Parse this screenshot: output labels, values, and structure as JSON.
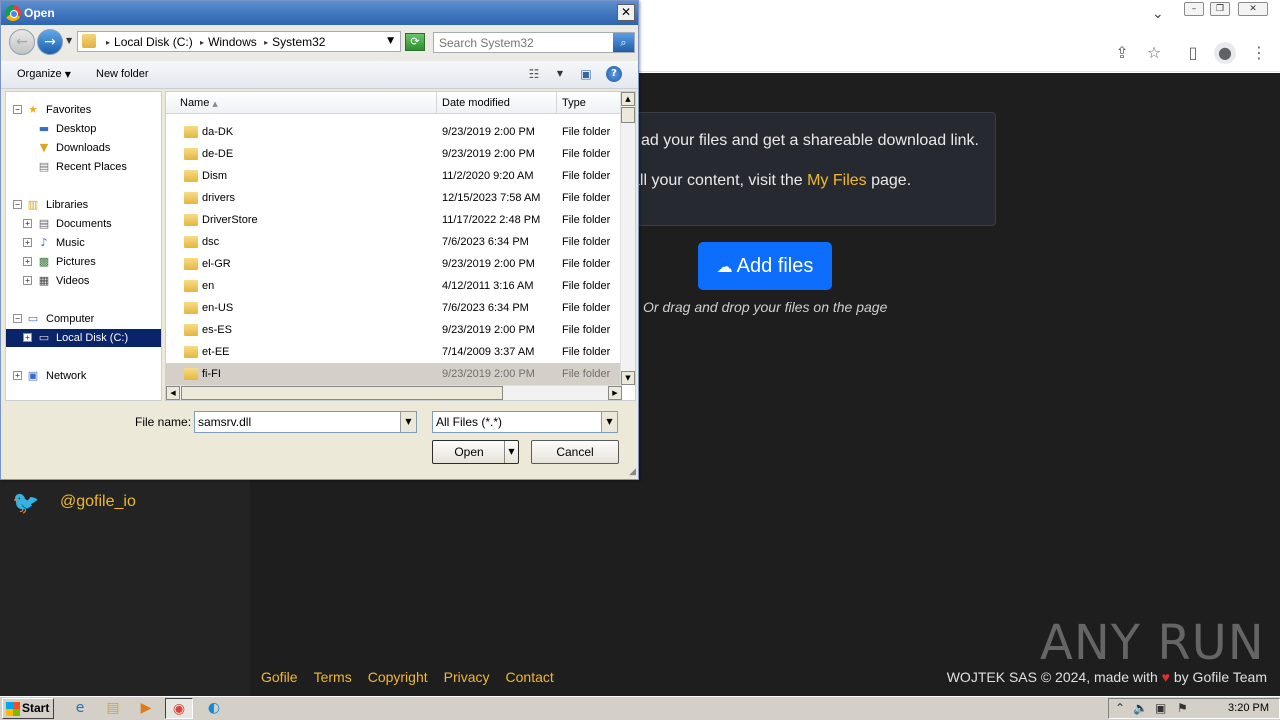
{
  "browser": {
    "toolbar_icons": [
      "share-icon",
      "star-icon",
      "sidepanel-icon",
      "profile-icon",
      "menu-icon"
    ]
  },
  "page": {
    "info_line1": "ad your files and get a shareable download link.",
    "info_line2_prefix": "all your content, visit the ",
    "info_line2_link": "My Files",
    "info_line2_suffix": " page.",
    "add_files_label": "Add files",
    "drag_hint": "Or drag and drop your files on the page",
    "twitter_handle": "@gofile_io",
    "footer_links": [
      "Gofile",
      "Terms",
      "Copyright",
      "Privacy",
      "Contact"
    ],
    "footer_right_prefix": "WOJTEK SAS © 2024, made with ",
    "footer_right_suffix": " by Gofile Team",
    "watermark": "ANY RUN",
    "colors": {
      "background": "#1e1e1e",
      "accent_link": "#f1b82d",
      "button_blue": "#0d6efd",
      "heart": "#e03131"
    }
  },
  "dialog": {
    "title": "Open",
    "address": [
      "Local Disk (C:)",
      "Windows",
      "System32"
    ],
    "search_placeholder": "Search System32",
    "organize_label": "Organize",
    "new_folder_label": "New folder",
    "nav": {
      "favorites": "Favorites",
      "desktop": "Desktop",
      "downloads": "Downloads",
      "recent": "Recent Places",
      "libraries": "Libraries",
      "documents": "Documents",
      "music": "Music",
      "pictures": "Pictures",
      "videos": "Videos",
      "computer": "Computer",
      "local_disk": "Local Disk (C:)",
      "network": "Network"
    },
    "columns": {
      "name": "Name",
      "date": "Date modified",
      "type": "Type"
    },
    "files": [
      {
        "name": "da-DK",
        "date": "9/23/2019 2:00 PM",
        "type": "File folder"
      },
      {
        "name": "de-DE",
        "date": "9/23/2019 2:00 PM",
        "type": "File folder"
      },
      {
        "name": "Dism",
        "date": "11/2/2020 9:20 AM",
        "type": "File folder"
      },
      {
        "name": "drivers",
        "date": "12/15/2023 7:58 AM",
        "type": "File folder"
      },
      {
        "name": "DriverStore",
        "date": "11/17/2022 2:48 PM",
        "type": "File folder"
      },
      {
        "name": "dsc",
        "date": "7/6/2023 6:34 PM",
        "type": "File folder"
      },
      {
        "name": "el-GR",
        "date": "9/23/2019 2:00 PM",
        "type": "File folder"
      },
      {
        "name": "en",
        "date": "4/12/2011 3:16 AM",
        "type": "File folder"
      },
      {
        "name": "en-US",
        "date": "7/6/2023 6:34 PM",
        "type": "File folder"
      },
      {
        "name": "es-ES",
        "date": "9/23/2019 2:00 PM",
        "type": "File folder"
      },
      {
        "name": "et-EE",
        "date": "7/14/2009 3:37 AM",
        "type": "File folder"
      },
      {
        "name": "fi-FI",
        "date": "9/23/2019 2:00 PM",
        "type": "File folder"
      }
    ],
    "file_name_label": "File name:",
    "file_name_value": "samsrv.dll",
    "file_type_value": "All Files (*.*)",
    "open_label": "Open",
    "cancel_label": "Cancel"
  },
  "taskbar": {
    "start_label": "Start",
    "apps": [
      "internet-explorer-icon",
      "file-explorer-icon",
      "media-player-icon",
      "chrome-icon",
      "edge-icon"
    ],
    "clock": "3:20 PM"
  }
}
